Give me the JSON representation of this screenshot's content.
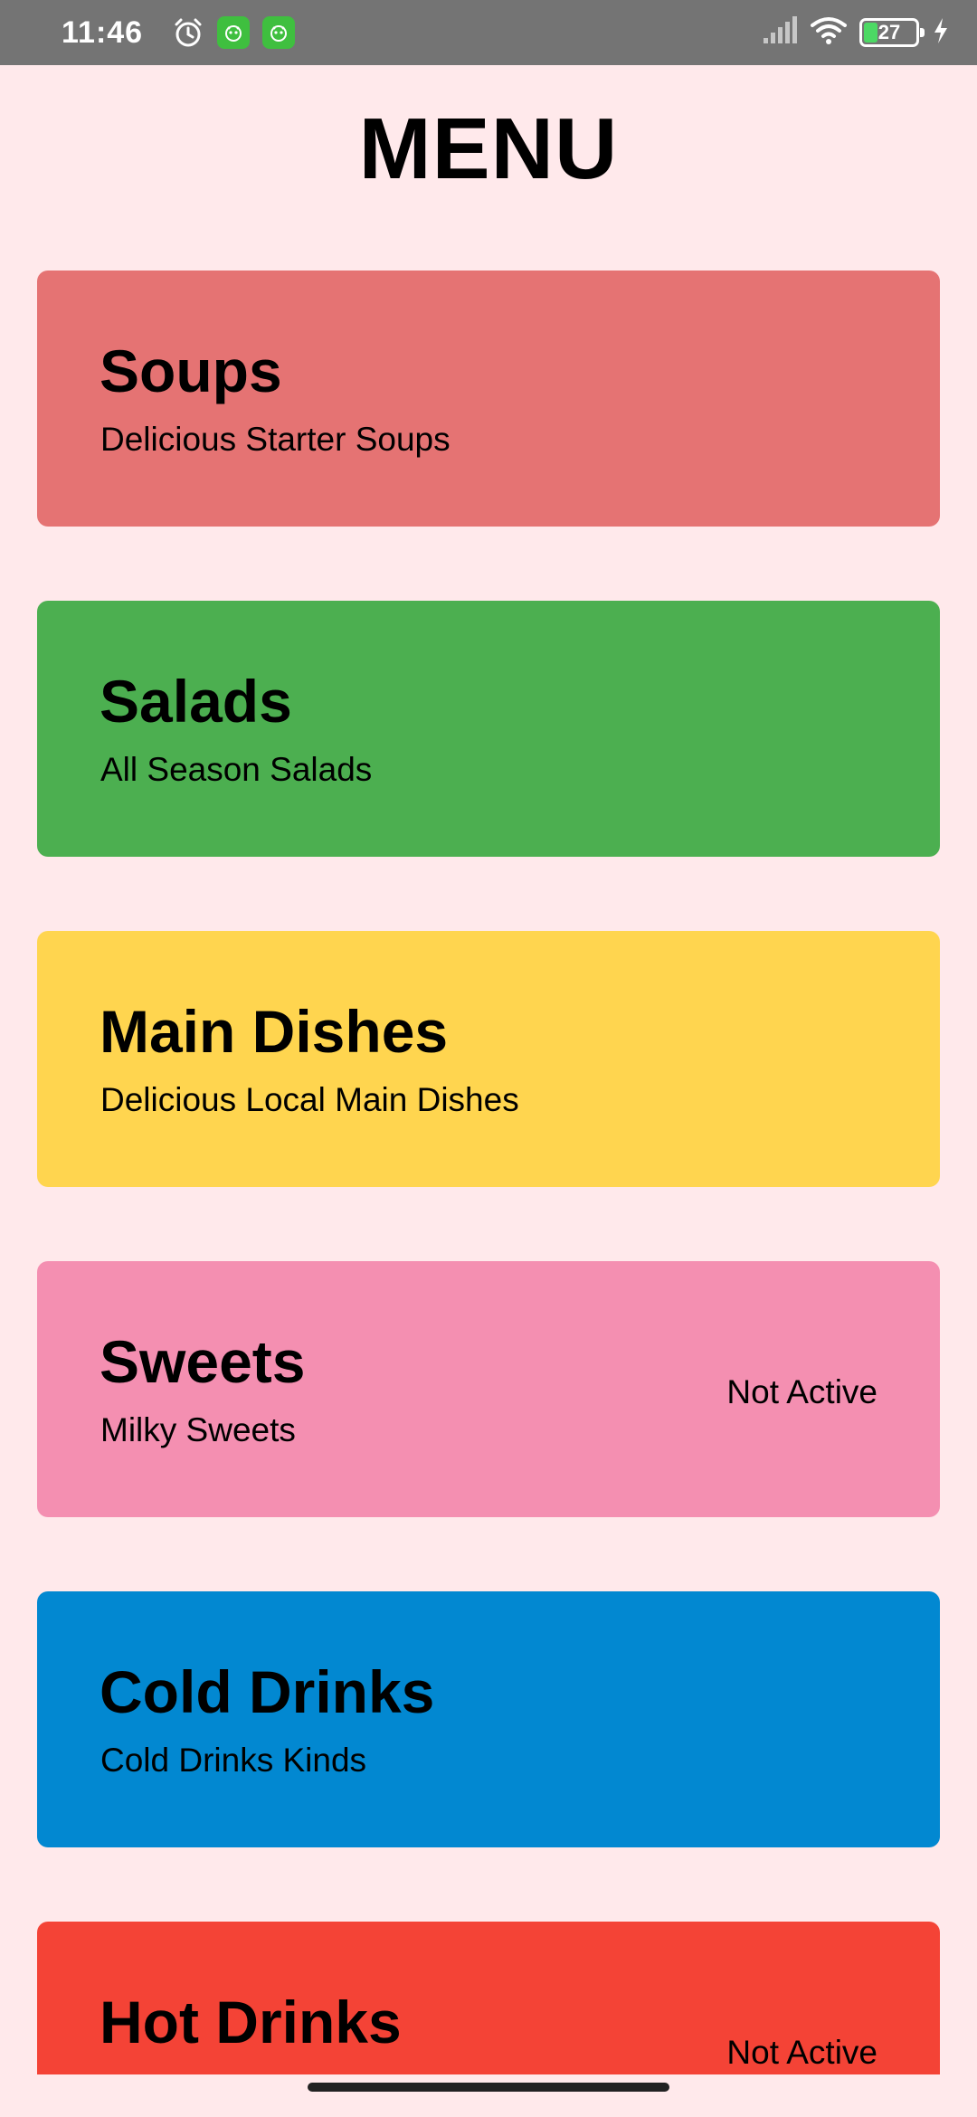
{
  "status_bar": {
    "time": "11:46",
    "battery_level": "27",
    "battery_fraction": 0.27,
    "charging": true,
    "icons": [
      "alarm-icon",
      "app-badge-icon",
      "app-badge-icon",
      "signal-icon",
      "wifi-icon",
      "battery-icon",
      "charging-bolt-icon"
    ]
  },
  "page": {
    "title": "MENU"
  },
  "menu": {
    "items": [
      {
        "title": "Soups",
        "subtitle": "Delicious Starter Soups",
        "status": "",
        "color": "#e57373"
      },
      {
        "title": "Salads",
        "subtitle": "All Season Salads",
        "status": "",
        "color": "#4caf50"
      },
      {
        "title": "Main Dishes",
        "subtitle": "Delicious Local Main Dishes",
        "status": "",
        "color": "#ffd54f"
      },
      {
        "title": "Sweets",
        "subtitle": "Milky Sweets",
        "status": "Not Active",
        "color": "#f48fb1"
      },
      {
        "title": "Cold Drinks",
        "subtitle": "Cold Drinks Kinds",
        "status": "",
        "color": "#0288d1"
      },
      {
        "title": "Hot Drinks",
        "subtitle": "",
        "status": "Not Active",
        "color": "#f44336"
      }
    ]
  }
}
